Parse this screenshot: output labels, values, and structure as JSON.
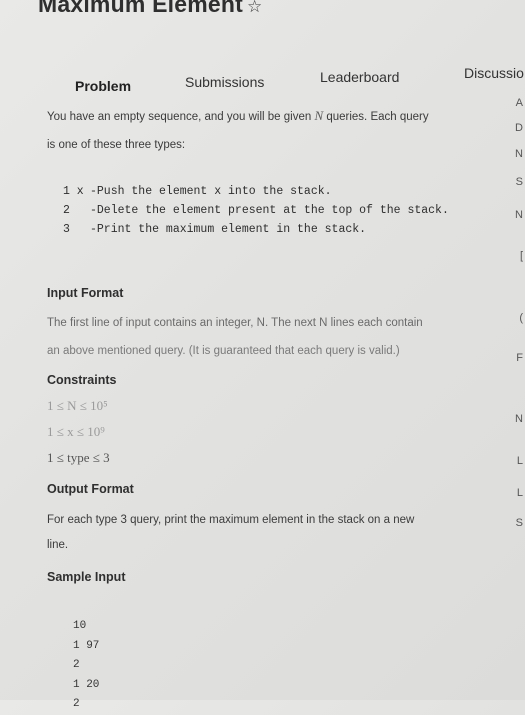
{
  "page": {
    "title": "Maximum Element",
    "star_glyph": "☆"
  },
  "tabs": [
    {
      "label": "Problem",
      "active": true
    },
    {
      "label": "Submissions",
      "active": false
    },
    {
      "label": "Leaderboard",
      "active": false
    },
    {
      "label": "Discussio",
      "active": false
    }
  ],
  "problem": {
    "intro_line1": "You have an empty sequence, and you will be given",
    "intro_var": "N",
    "intro_line1_end": "queries. Each query",
    "intro_line2": "is one of these three types:",
    "query_types": [
      {
        "num": "1 x",
        "desc": "-Push the element x into the stack."
      },
      {
        "num": "2",
        "desc": "-Delete the element present at the top of the stack."
      },
      {
        "num": "3",
        "desc": "-Print the maximum element in the stack."
      }
    ]
  },
  "input_format": {
    "heading": "Input Format",
    "line1": "The first line of input contains an integer, N. The next N lines each contain",
    "line2": "an above mentioned query. (It is guaranteed that each query is valid.)"
  },
  "constraints": {
    "heading": "Constraints",
    "items": [
      "1 ≤ N ≤ 10⁵",
      "1 ≤ x ≤ 10⁹",
      "1 ≤ type ≤ 3"
    ]
  },
  "output_format": {
    "heading": "Output Format",
    "line1": "For each type 3 query, print the maximum element in the stack on a new",
    "line2": "line."
  },
  "sample_input": {
    "heading": "Sample Input",
    "lines": [
      "10",
      "1 97",
      "2",
      "1 20",
      "2"
    ]
  },
  "right_sidebar": {
    "chars": [
      "A",
      "D",
      "N",
      "S",
      "N",
      "[",
      "(",
      "F",
      "N",
      "L",
      "L",
      "S"
    ]
  }
}
